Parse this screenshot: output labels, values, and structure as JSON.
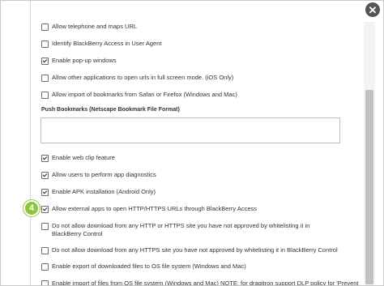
{
  "close_icon_glyph": "✕",
  "step_badge": "4",
  "options_top": [
    {
      "label": "Allow telephone and maps URL",
      "checked": false
    },
    {
      "label": "Identify BlackBerry Access in User Agent",
      "checked": false
    },
    {
      "label": "Enable pop-up windows",
      "checked": true
    },
    {
      "label": "Allow other applications to open urls in full screen mode. (iOS Only)",
      "checked": false
    },
    {
      "label": "Allow import of bookmarks from Safari or Firefox (Windows and Mac)",
      "checked": false
    }
  ],
  "push_bookmarks": {
    "label": "Push Bookmarks (Netscape Bookmark File Format)",
    "value": ""
  },
  "options_bottom": [
    {
      "label": "Enable web clip feature",
      "checked": true
    },
    {
      "label": "Allow users to perform app diagnostics",
      "checked": true
    },
    {
      "label": "Enable APK installation (Android Only)",
      "checked": true
    },
    {
      "label": "Allow external apps to open HTTP/HTTPS URLs through BlackBerry Access",
      "checked": true
    },
    {
      "label": "Do not allow download from any HTTP or HTTPS site you have not approved by whitelisting it in BlackBerry Control",
      "checked": false
    },
    {
      "label": "Do not allow download from any HTTPS site you have not approved by whitelisting it in BlackBerry Control",
      "checked": false
    },
    {
      "label": "Enable export of downloaded files to OS file system (Windows and Mac)",
      "checked": false
    },
    {
      "label": "Enable import of files from OS file system (Windows and Mac) NOTE: for dragitron support DLP policy for 'Prevent",
      "checked": false
    }
  ],
  "colors": {
    "badge": "#8cc63f",
    "close": "#555555"
  }
}
